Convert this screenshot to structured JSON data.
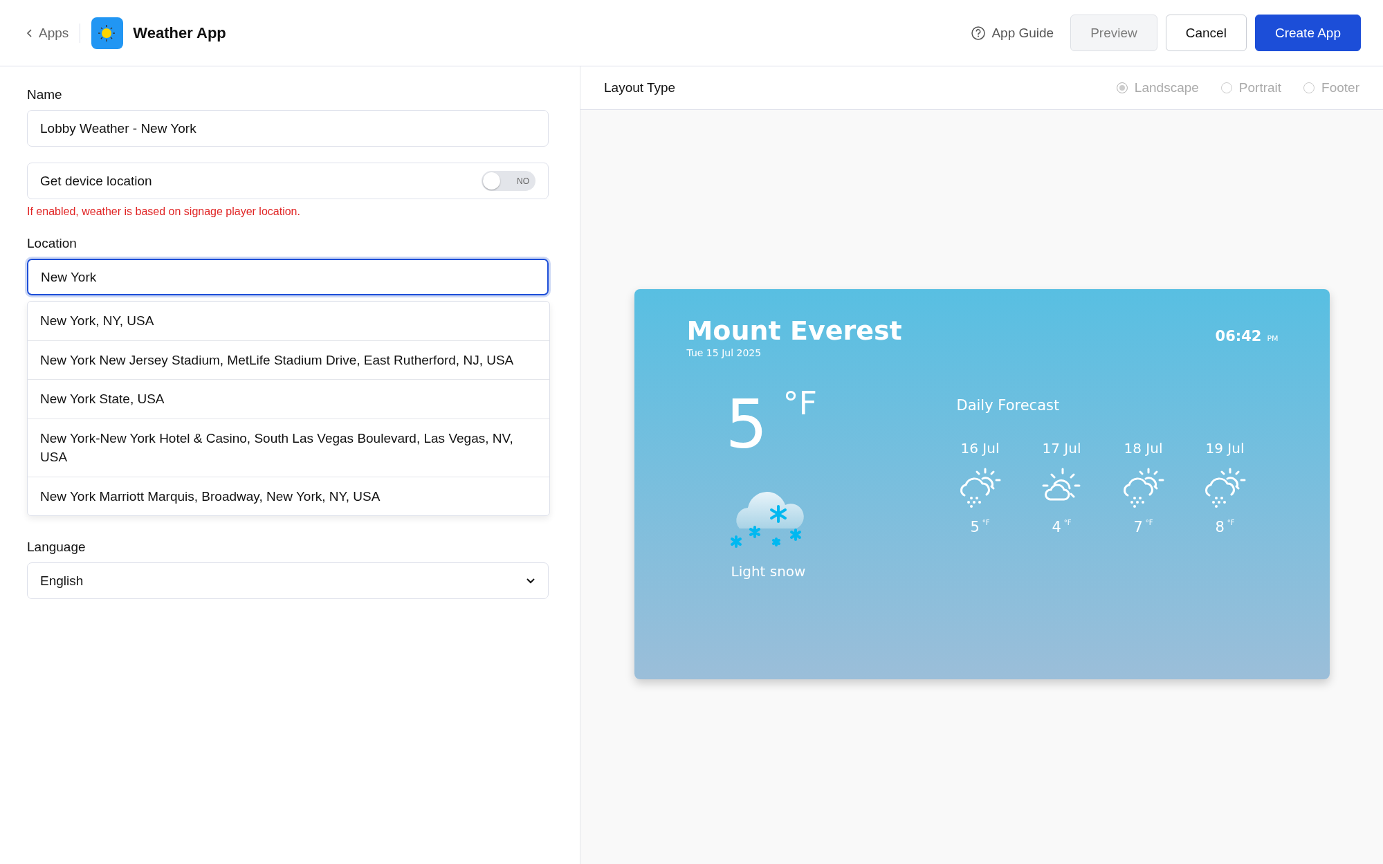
{
  "header": {
    "back_link": "Apps",
    "app_name": "Weather App",
    "guide_link": "App Guide",
    "buttons": [
      {
        "label": "Preview",
        "kind": "secondary",
        "disabled": true
      },
      {
        "label": "Cancel",
        "kind": "outline",
        "disabled": false
      },
      {
        "label": "Create App",
        "kind": "primary",
        "disabled": false
      }
    ]
  },
  "form": {
    "name": {
      "label": "Name",
      "value": "Lobby Weather - New York"
    },
    "device_location": {
      "label": "Get device location",
      "on": false,
      "toggle_text": "NO",
      "hint": "If enabled, weather is based on signage player location."
    },
    "location": {
      "label": "Location",
      "value": "New York",
      "focused": true,
      "suggestions": [
        {
          "text": "New York, NY, USA"
        },
        {
          "text": "New York New Jersey Stadium, MetLife Stadium Drive, East Rutherford, NJ, USA"
        },
        {
          "text": "New York State, USA"
        },
        {
          "text": "New York-New York Hotel & Casino, South Las Vegas Boulevard, Las Vegas, NV, USA"
        },
        {
          "text": "New York Marriott Marquis, Broadway, New York, NY, USA"
        }
      ]
    },
    "language": {
      "label": "Language",
      "value": "English"
    }
  },
  "layout_type": {
    "label": "Layout Type",
    "options": [
      {
        "label": "Landscape",
        "selected": true,
        "disabled": true
      },
      {
        "label": "Portrait",
        "selected": false,
        "disabled": true
      },
      {
        "label": "Footer",
        "selected": false,
        "disabled": true
      }
    ]
  },
  "preview": {
    "city": "Mount Everest",
    "date": "Tue 15 Jul 2025",
    "time": "06:42",
    "ampm": "PM",
    "temperature": "5",
    "unit": "°F",
    "condition": "Light snow",
    "forecast_title": "Daily Forecast",
    "forecast": [
      {
        "day": "16 Jul",
        "kind": "snow",
        "temp": "5",
        "unit": "°F"
      },
      {
        "day": "17 Jul",
        "kind": "partly-cloudy",
        "temp": "4",
        "unit": "°F"
      },
      {
        "day": "18 Jul",
        "kind": "snow",
        "temp": "7",
        "unit": "°F"
      },
      {
        "day": "19 Jul",
        "kind": "snow",
        "temp": "8",
        "unit": "°F"
      }
    ]
  }
}
